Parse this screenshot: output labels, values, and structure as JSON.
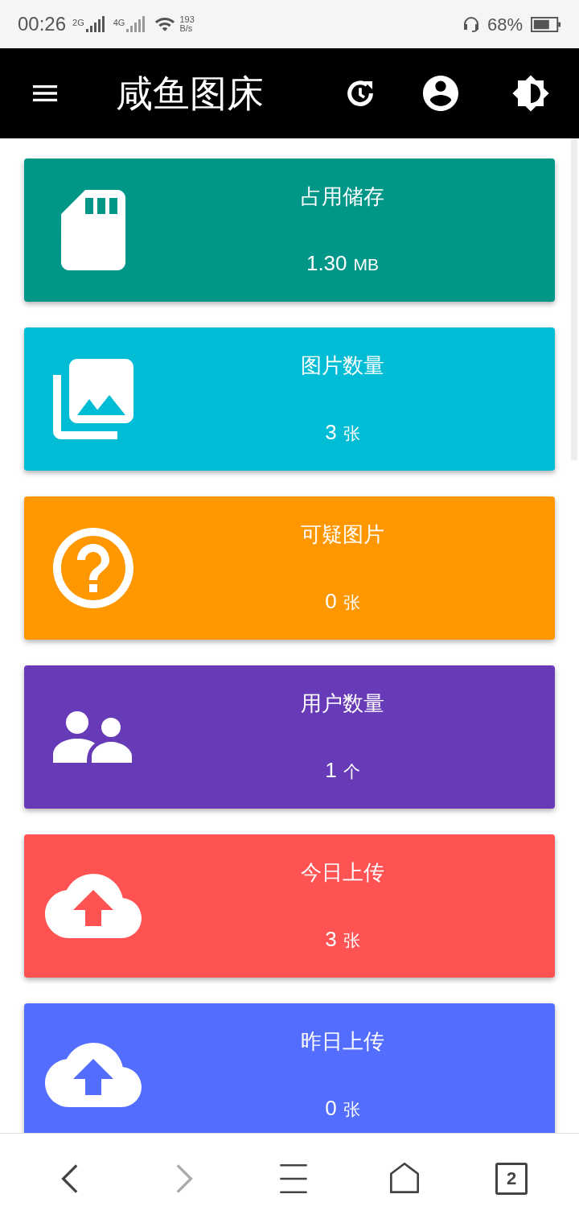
{
  "status_bar": {
    "time": "00:26",
    "network_1": "2G",
    "network_2": "4G",
    "speed_value": "193",
    "speed_unit": "B/s",
    "battery": "68%"
  },
  "app_bar": {
    "title": "咸鱼图床"
  },
  "cards": [
    {
      "kind": "storage",
      "color": "#009688",
      "title": "占用储存",
      "value": "1.30",
      "unit": "MB"
    },
    {
      "kind": "images",
      "color": "#00bcd4",
      "title": "图片数量",
      "value": "3",
      "unit": "张"
    },
    {
      "kind": "suspicious",
      "color": "#ff9800",
      "title": "可疑图片",
      "value": "0",
      "unit": "张"
    },
    {
      "kind": "users",
      "color": "#673ab7",
      "title": "用户数量",
      "value": "1",
      "unit": "个"
    },
    {
      "kind": "upload",
      "color": "#ff5252",
      "title": "今日上传",
      "value": "3",
      "unit": "张"
    },
    {
      "kind": "upload",
      "color": "#536dfe",
      "title": "昨日上传",
      "value": "0",
      "unit": "张"
    }
  ],
  "browser_nav": {
    "back_disabled": false,
    "forward_disabled": true,
    "tab_count": "2"
  }
}
